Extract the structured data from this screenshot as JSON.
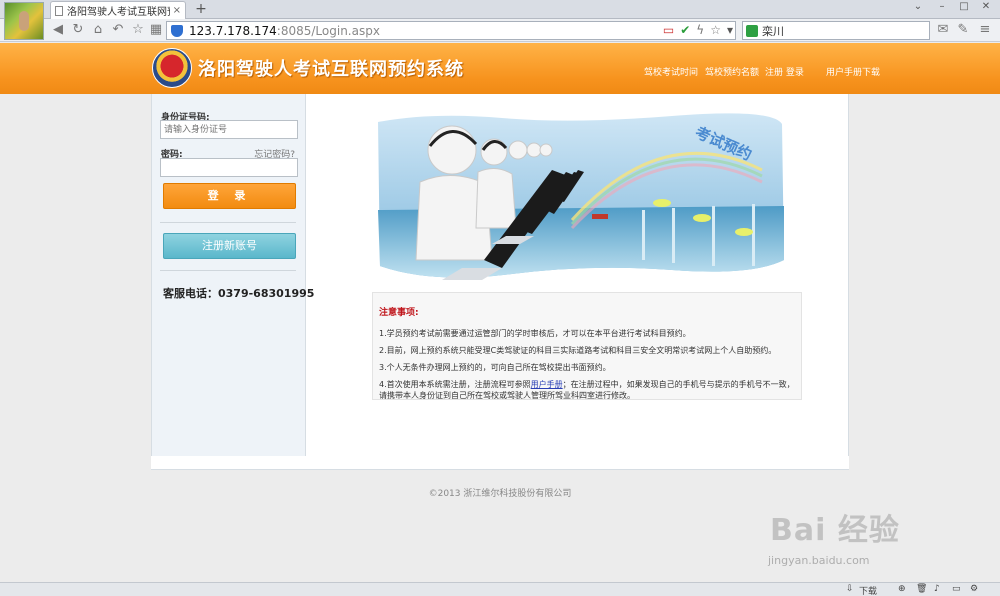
{
  "browser": {
    "tab_title": "洛阳驾驶人考试互联网预约",
    "tab_close": "×",
    "new_tab": "+",
    "url_host": "123.7.178.174",
    "url_rest": ":8085/Login.aspx",
    "search_text": "栾川"
  },
  "header": {
    "site_title": "洛阳驾驶人考试互联网预约系统",
    "nav": [
      "驾校考试时间",
      "驾校预约名额",
      "注册 登录",
      "用户手册下载"
    ]
  },
  "login": {
    "id_label": "身份证号码:",
    "id_placeholder": "请输入身份证号",
    "password_label": "密码:",
    "forgot_link": "忘记密码?",
    "login_button": "登 录",
    "register_button": "注册新账号",
    "service_phone": "客服电话：0379-68301995"
  },
  "banner": {
    "text": "考试预约"
  },
  "notice": {
    "title": "注意事项:",
    "items": [
      "1.学员预约考试前需要通过运管部门的学时审核后，才可以在本平台进行考试科目预约。",
      "2.目前，网上预约系统只能受理C类驾驶证的科目三实际道路考试和科目三安全文明常识考试网上个人自助预约。",
      "3.个人无条件办理网上预约的，可向自己所在驾校提出书面预约。"
    ],
    "item4_before": "4.首次使用本系统需注册，注册流程可参照",
    "item4_link": "用户手册",
    "item4_after": "；在注册过程中，如果发现自己的手机号与提示的手机号不一致，请携带本人身份证到自己所在驾校或驾驶人管理所驾业科四室进行修改。"
  },
  "footer": {
    "copyright": "©2013 浙江维尔科技股份有限公司"
  },
  "watermark": {
    "brand": "Bai 经验",
    "url": "jingyan.baidu.com"
  },
  "statusbar": {
    "download": "下载"
  }
}
